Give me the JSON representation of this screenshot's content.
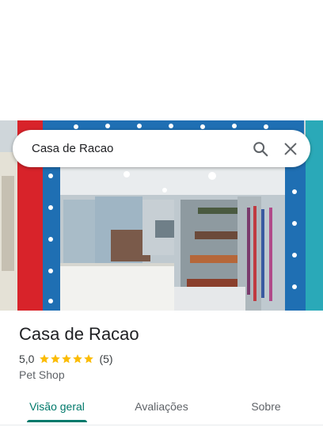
{
  "search": {
    "query": "Casa de Racao"
  },
  "place": {
    "name": "Casa de Racao",
    "rating": "5,0",
    "stars": 5,
    "review_count": "(5)",
    "category": "Pet Shop"
  },
  "tabs": [
    {
      "label": "Visão geral",
      "active": true
    },
    {
      "label": "Avaliações",
      "active": false
    },
    {
      "label": "Sobre",
      "active": false
    }
  ],
  "colors": {
    "accent": "#00796b",
    "star": "#fbbc04",
    "wall_blue": "#1f6fb3",
    "wall_red": "#d8232a"
  },
  "icons": {
    "search": "search-icon",
    "close": "close-icon",
    "star": "star-icon"
  }
}
